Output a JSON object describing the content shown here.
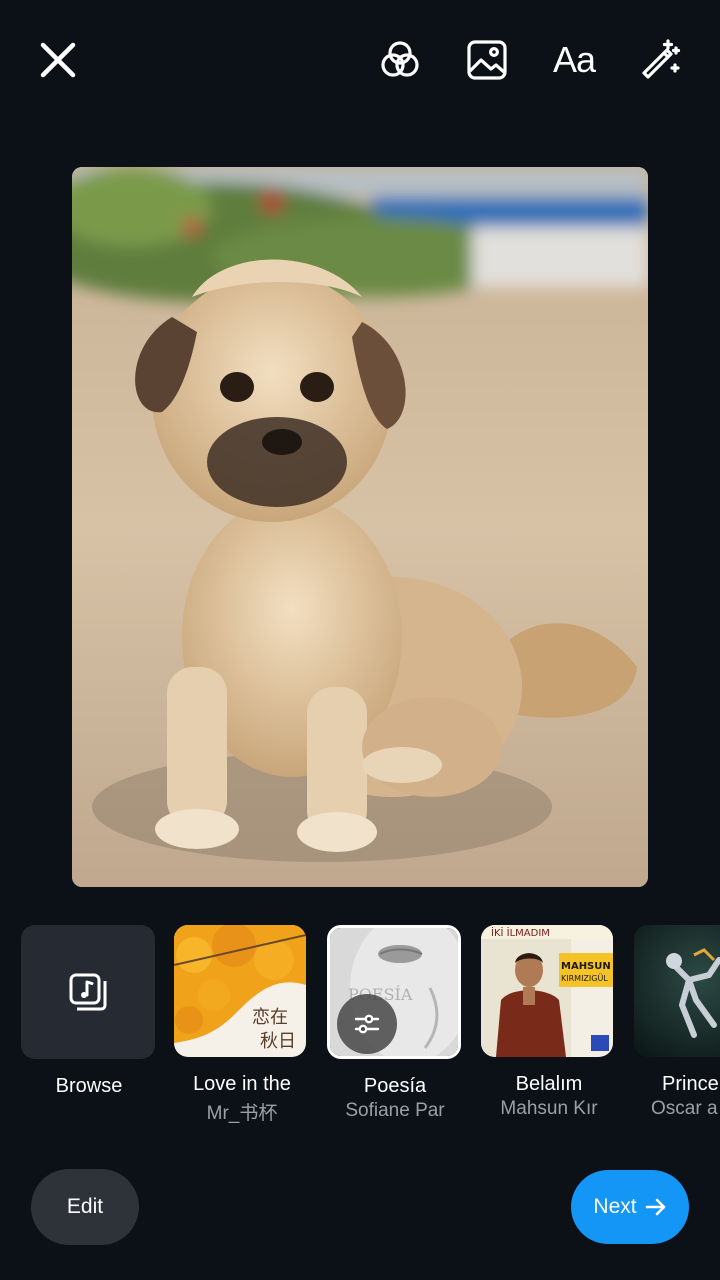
{
  "toolbar": {
    "close_icon": "close-icon",
    "filters_icon": "filters-icon",
    "gallery_icon": "gallery-icon",
    "text_label": "Aa",
    "effects_icon": "magic-wand-icon"
  },
  "music": {
    "items": [
      {
        "title": "Browse",
        "artist": "",
        "icon": "music-library-icon"
      },
      {
        "title": "Love in the",
        "artist": "Mr_书杯"
      },
      {
        "title": "Poesía",
        "artist": "Sofiane Par",
        "selected": true,
        "icon": "adjust-sliders-icon"
      },
      {
        "title": "Belalım",
        "artist": "Mahsun Kır"
      },
      {
        "title": "Prince",
        "artist": "Oscar a"
      }
    ],
    "art_text": {
      "love_line1": "恋在",
      "love_line2": "秋日",
      "poesia": "POESÍA",
      "belalim_top": "İKİ İLMADIM",
      "belalim_artist1": "MAHSUN",
      "belalim_artist2": "KIRMIZIGÜL"
    }
  },
  "footer": {
    "edit_label": "Edit",
    "next_label": "Next",
    "next_icon": "arrow-right-icon"
  },
  "colors": {
    "background": "#0c1017",
    "accent": "#1496f6",
    "edit_button": "#2e3239"
  }
}
